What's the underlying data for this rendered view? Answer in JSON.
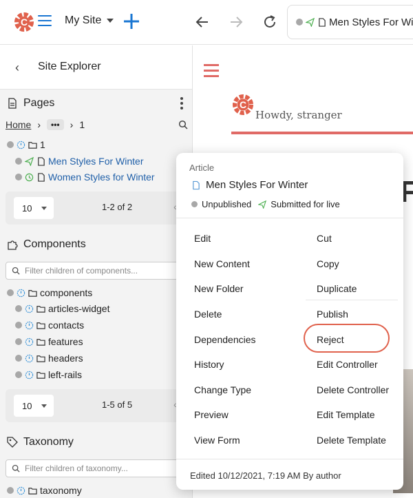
{
  "topbar": {
    "site_label": "My Site",
    "address_text": "Men Styles For Wir"
  },
  "sidebar": {
    "title": "Site Explorer",
    "pages": {
      "title": "Pages",
      "breadcrumb": {
        "home": "Home",
        "ellipsis": "•••",
        "current": "1"
      },
      "tree": [
        {
          "label": "1",
          "kind": "folder",
          "level": 0
        },
        {
          "label": "Men Styles For Winter",
          "kind": "page",
          "status": "submitted",
          "level": 1
        },
        {
          "label": "Women Styles for Winter",
          "kind": "page",
          "status": "scheduled",
          "level": 1
        }
      ],
      "pager": {
        "size": "10",
        "range": "1-2 of 2"
      }
    },
    "components": {
      "title": "Components",
      "filter_placeholder": "Filter children of components...",
      "tree": [
        {
          "label": "components",
          "level": 0
        },
        {
          "label": "articles-widget",
          "level": 1
        },
        {
          "label": "contacts",
          "level": 1
        },
        {
          "label": "features",
          "level": 1
        },
        {
          "label": "headers",
          "level": 1
        },
        {
          "label": "left-rails",
          "level": 1
        }
      ],
      "pager": {
        "size": "10",
        "range": "1-5 of 5"
      }
    },
    "taxonomy": {
      "title": "Taxonomy",
      "filter_placeholder": "Filter children of taxonomy...",
      "tree": [
        {
          "label": "taxonomy",
          "level": 0
        }
      ]
    }
  },
  "preview": {
    "greeting": "Howdy, stranger",
    "heading_fragment": "F"
  },
  "popup": {
    "type": "Article",
    "name": "Men Styles For Winter",
    "status_unpublished": "Unpublished",
    "status_submitted": "Submitted for live",
    "left_actions": [
      "Edit",
      "New Content",
      "New Folder",
      "Delete",
      "Dependencies",
      "History",
      "Change Type",
      "Preview",
      "View Form"
    ],
    "right_actions": [
      "Cut",
      "Copy",
      "Duplicate",
      "Publish",
      "Reject",
      "Edit Controller",
      "Delete Controller",
      "Edit Template",
      "Delete Template"
    ],
    "highlighted_action": "Reject",
    "footer": "Edited 10/12/2021, 7:19 AM By author"
  },
  "colors": {
    "brand_red": "#e0614c",
    "accent_blue": "#1976d2",
    "link_blue": "#1f5fa8",
    "status_green": "#4caf50",
    "info_blue": "#2f8fd8"
  },
  "icons": {
    "logo": "crafter-gear-logo",
    "menu": "hamburger-icon",
    "add": "plus-icon",
    "back": "arrow-left-icon",
    "forward": "arrow-right-icon",
    "refresh": "refresh-icon",
    "submitted": "paper-plane-icon",
    "scheduled": "clock-icon",
    "page": "page-icon",
    "folder": "folder-icon",
    "search": "search-icon"
  }
}
